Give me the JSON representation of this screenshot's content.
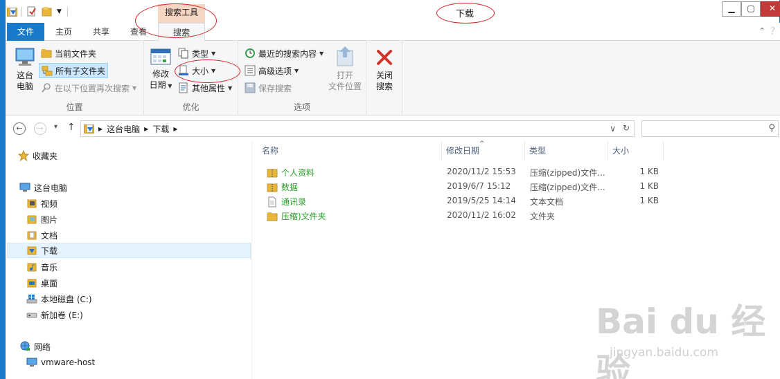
{
  "window": {
    "title": "下载",
    "context_group_label": "搜索工具",
    "controls": {
      "minimize": "▁",
      "maximize": "▢",
      "close": "✕"
    }
  },
  "ribbon_tabs": {
    "file": "文件",
    "home": "主页",
    "share": "共享",
    "view": "查看",
    "search": "搜索",
    "help_chevrons": "⌃ ❔"
  },
  "ribbon": {
    "location_group": {
      "label": "位置",
      "this_pc_line1": "这台",
      "this_pc_line2": "电脑",
      "current_folder": "当前文件夹",
      "all_subfolders": "所有子文件夹",
      "search_again": "在以下位置再次搜索"
    },
    "refine_group": {
      "label": "优化",
      "date_modified_line1": "修改",
      "date_modified_line2": "日期",
      "kind": "类型",
      "size": "大小",
      "other_properties": "其他属性"
    },
    "options_group": {
      "label": "选项",
      "recent_searches": "最近的搜索内容",
      "advanced_options": "高级选项",
      "save_search": "保存搜索",
      "open_location_line1": "打开",
      "open_location_line2": "文件位置"
    },
    "close_search": {
      "line1": "关闭",
      "line2": "搜索"
    }
  },
  "address": {
    "back": "←",
    "forward": "→",
    "recent": "▾",
    "up": "↑",
    "crumbs": [
      "这台电脑",
      "下载"
    ],
    "dropdown": "∨",
    "refresh": "↻",
    "search_value": "",
    "search_icon": "⚲"
  },
  "nav": {
    "favorites": "收藏夹",
    "this_pc": "这台电脑",
    "items": [
      "视频",
      "图片",
      "文档",
      "下载",
      "音乐",
      "桌面",
      "本地磁盘 (C:)",
      "新加卷 (E:)"
    ],
    "network": "网络",
    "network_items": [
      "vmware-host"
    ]
  },
  "files": {
    "columns": [
      "名称",
      "修改日期",
      "类型",
      "大小"
    ],
    "sort_indicator": "^",
    "rows": [
      {
        "name": "个人资料",
        "date": "2020/11/2 15:53",
        "type": "压缩(zipped)文件...",
        "size": "1 KB",
        "icon": "zip-folder-icon"
      },
      {
        "name": "数据",
        "date": "2019/6/7 15:12",
        "type": "压缩(zipped)文件...",
        "size": "1 KB",
        "icon": "zip-folder-icon"
      },
      {
        "name": "通讯录",
        "date": "2019/5/25 14:14",
        "type": "文本文档",
        "size": "1 KB",
        "icon": "text-file-icon"
      },
      {
        "name": "压缩)文件夹",
        "date": "2020/11/2 16:02",
        "type": "文件夹",
        "size": "",
        "icon": "folder-icon"
      }
    ]
  },
  "watermark": {
    "main": "Bai du 经验",
    "sub": "jingyan.baidu.com"
  },
  "colors": {
    "accent": "#1979ca",
    "annotation_red": "#d02424",
    "file_name_green": "#2ca02c"
  }
}
